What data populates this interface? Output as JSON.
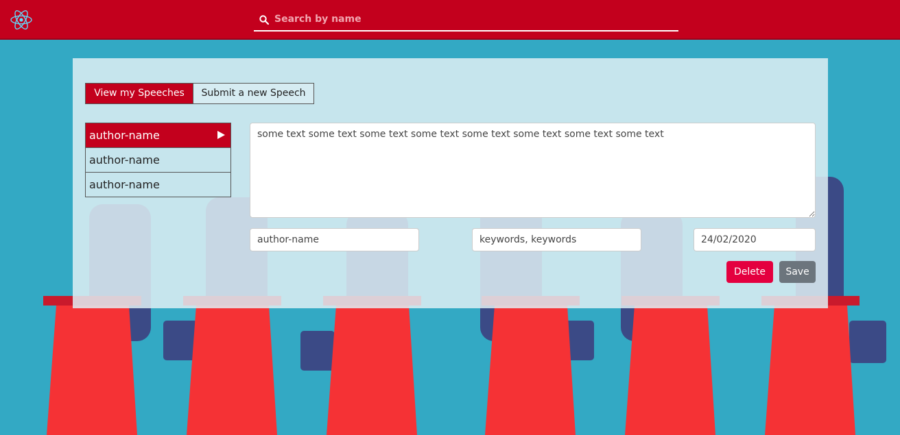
{
  "navbar": {
    "logo_icon": "react-atom-icon",
    "search": {
      "placeholder": "Search by name",
      "value": ""
    }
  },
  "tabs": [
    {
      "label": "View my Speeches",
      "active": true
    },
    {
      "label": "Submit a new Speech",
      "active": false
    }
  ],
  "speeches": [
    {
      "label": "author-name",
      "active": true
    },
    {
      "label": "author-name",
      "active": false
    },
    {
      "label": "author-name",
      "active": false
    }
  ],
  "editor": {
    "text": "some text some text some text some text some text some text some text some text",
    "author": "author-name",
    "keywords": "keywords, keywords",
    "date": "24/02/2020",
    "delete_label": "Delete",
    "save_label": "Save"
  },
  "colors": {
    "brand": "#c3001d",
    "background": "#33a9c4",
    "delete": "#e4003f",
    "save": "#6c757d"
  }
}
